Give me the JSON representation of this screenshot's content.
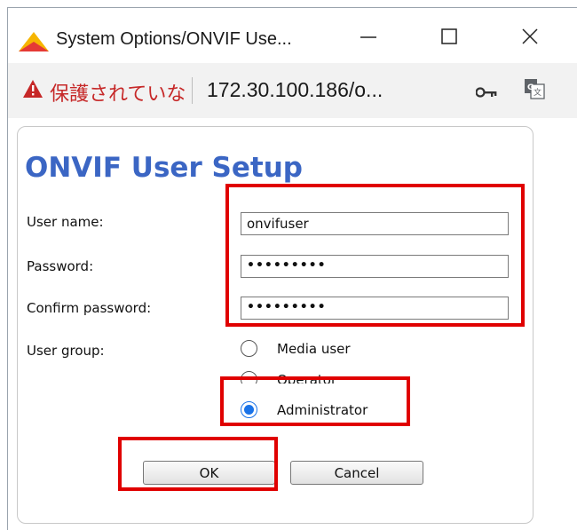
{
  "window": {
    "title": "System Options/ONVIF Use...",
    "controls": {
      "minimize": "—",
      "maximize": "☐",
      "close": "✕"
    }
  },
  "addressbar": {
    "security_warning": "保護されていな",
    "url": "172.30.100.186/o..."
  },
  "form": {
    "heading": "ONVIF User Setup",
    "username_label": "User name:",
    "username_value": "onvifuser",
    "password_label": "Password:",
    "password_value": "•••••••••",
    "confirm_label": "Confirm password:",
    "confirm_value": "•••••••••",
    "group_label": "User group:",
    "groups": [
      {
        "label": "Media user",
        "checked": false
      },
      {
        "label": "Operator",
        "checked": false
      },
      {
        "label": "Administrator",
        "checked": true
      }
    ],
    "ok_label": "OK",
    "cancel_label": "Cancel"
  },
  "colors": {
    "heading": "#3b66c4",
    "highlight": "#e00000",
    "radio_selected": "#1a73e8",
    "warning": "#c62828"
  },
  "icons": [
    "app-logo-icon",
    "minimize-icon",
    "maximize-icon",
    "close-icon",
    "warning-icon",
    "key-icon",
    "translate-icon"
  ]
}
